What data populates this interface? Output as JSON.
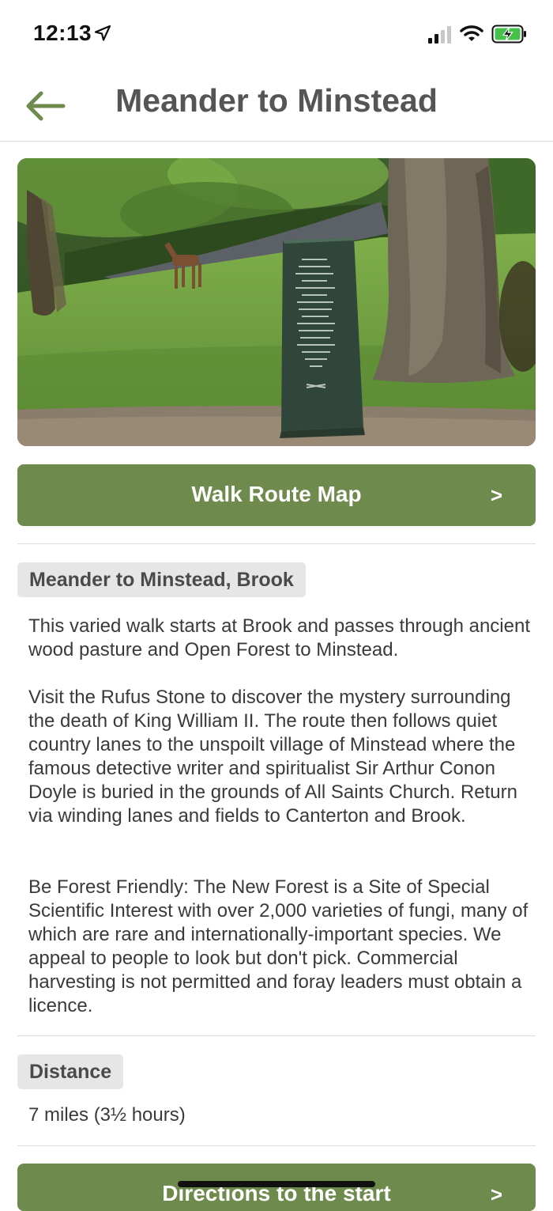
{
  "status_bar": {
    "time": "12:13"
  },
  "header": {
    "title": "Meander to Minstead"
  },
  "route_map_button": {
    "label": "Walk Route Map",
    "chevron": ">"
  },
  "description": {
    "heading": "Meander to Minstead, Brook",
    "paragraphs": [
      "This varied walk starts at Brook and passes through ancient wood pasture and Open Forest to Minstead.",
      "Visit the Rufus Stone to discover the mystery surrounding the death of King William II. The route then follows quiet country lanes to the unspoilt village of Minstead where the famous detective writer and spiritualist Sir Arthur Conon Doyle is buried in the grounds of All Saints Church. Return via winding lanes and fields to Canterton and Brook.",
      "Be Forest Friendly: The New Forest is a Site of Special Scientific Interest with over 2,000 varieties of fungi, many of which are rare and internationally-important species. We appeal to people to look but don't pick. Commercial harvesting is not permitted and foray leaders must obtain a licence."
    ]
  },
  "distance": {
    "heading": "Distance",
    "value": "7 miles (3½ hours)"
  },
  "directions_button": {
    "label": "Directions to the start",
    "chevron": ">"
  },
  "colors": {
    "accent": "#6f8a4d",
    "badge_bg": "#e6e6e6"
  }
}
